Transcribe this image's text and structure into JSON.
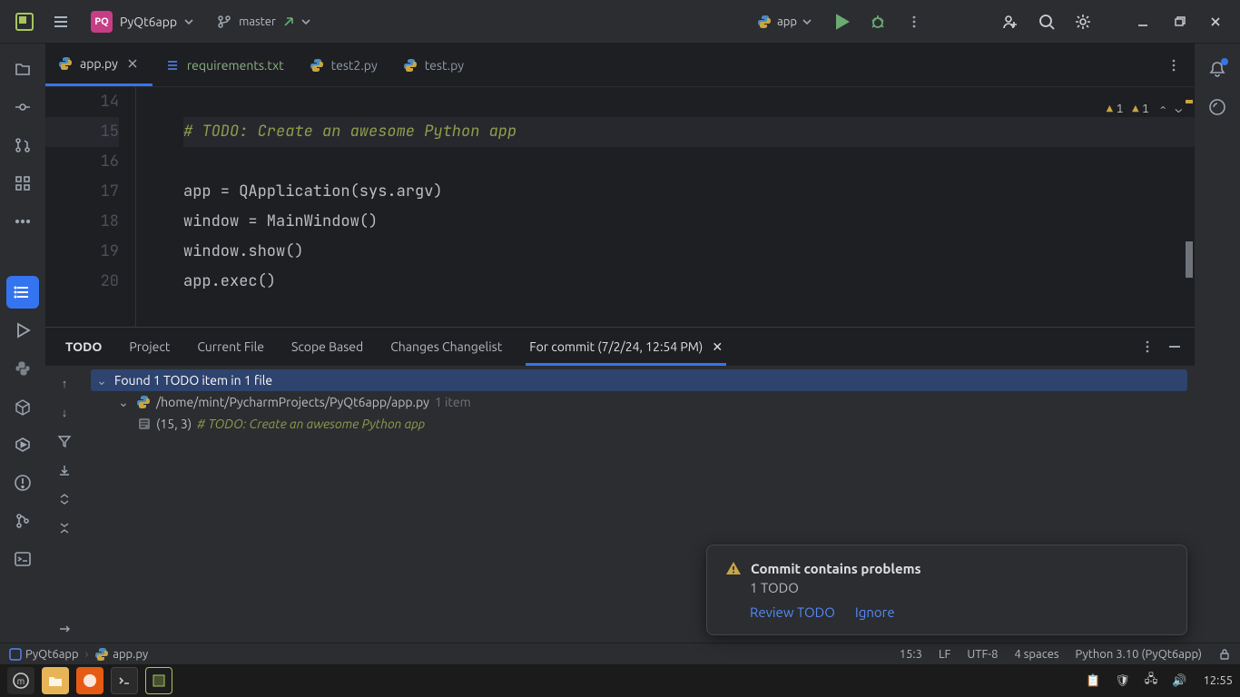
{
  "topbar": {
    "project_initials": "PQ",
    "project_name": "PyQt6app",
    "branch": "master",
    "run_config": "app"
  },
  "tabs": [
    {
      "label": "app.py",
      "kind": "python",
      "active": true,
      "closeable": true
    },
    {
      "label": "requirements.txt",
      "kind": "text",
      "active": false,
      "closeable": false,
      "dim": true
    },
    {
      "label": "test2.py",
      "kind": "python",
      "active": false,
      "closeable": false
    },
    {
      "label": "test.py",
      "kind": "python",
      "active": false,
      "closeable": false
    }
  ],
  "editor": {
    "first_line_no": 14,
    "current_line_no": 15,
    "lines": [
      "",
      "# TODO: Create an awesome Python app",
      "",
      "app = QApplication(sys.argv)",
      "window = MainWindow()",
      "window.show()",
      "app.exec()"
    ],
    "inspections": {
      "weak_warnings_a": "1",
      "weak_warnings_b": "1"
    }
  },
  "todo_panel": {
    "title": "TODO",
    "tabs": [
      "Project",
      "Current File",
      "Scope Based",
      "Changes Changelist",
      "For commit (7/2/24, 12:54 PM)"
    ],
    "active_tab_index": 4,
    "tree": {
      "summary": "Found 1 TODO item in 1 file",
      "file_path": "/home/mint/PycharmProjects/PyQt6app/app.py",
      "file_count": "1 item",
      "location": "(15, 3)",
      "todo_hash": "#",
      "todo_text": " TODO: Create an awesome Python app"
    }
  },
  "notification": {
    "title": "Commit contains problems",
    "body": "1 TODO",
    "actions": [
      "Review TODO",
      "Ignore"
    ]
  },
  "breadcrumb": {
    "root": "PyQt6app",
    "file": "app.py"
  },
  "status": {
    "caret": "15:3",
    "line_sep": "LF",
    "encoding": "UTF-8",
    "indent": "4 spaces",
    "interpreter": "Python 3.10 (PyQt6app)"
  },
  "os": {
    "clock": "12:55"
  }
}
